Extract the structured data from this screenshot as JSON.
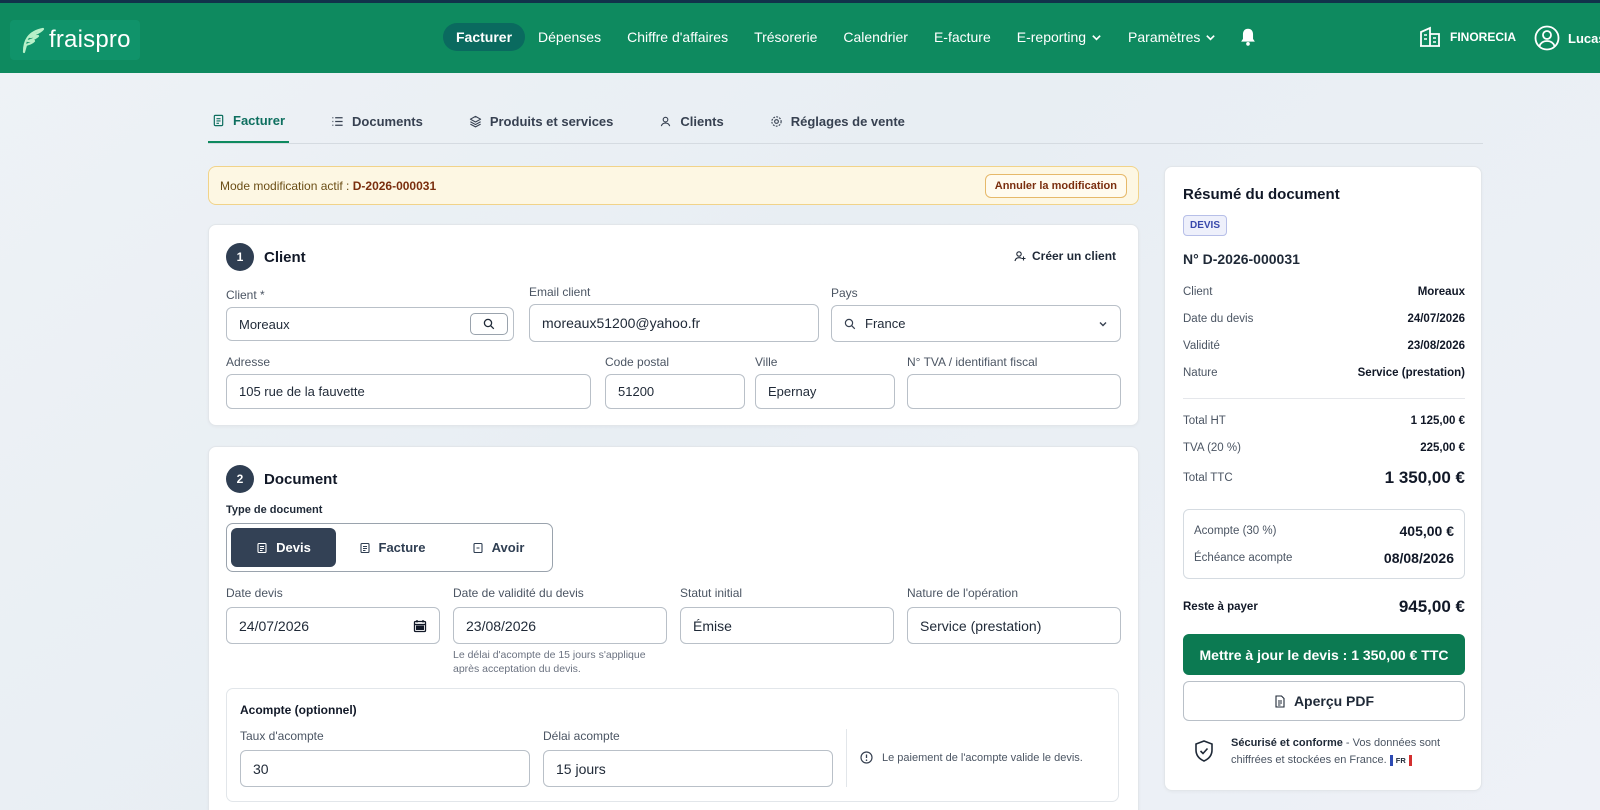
{
  "app": {
    "logo_text": "fraispro",
    "brand_color": "#0e8a5f"
  },
  "nav": {
    "items": [
      {
        "label": "Facturer"
      },
      {
        "label": "Dépenses"
      },
      {
        "label": "Chiffre d'affaires"
      },
      {
        "label": "Trésorerie"
      },
      {
        "label": "Calendrier"
      },
      {
        "label": "E-facture"
      },
      {
        "label": "E-reporting"
      },
      {
        "label": "Paramètres"
      }
    ],
    "org_name": "FINORECIA",
    "user_name": "Lucas"
  },
  "subtabs": [
    {
      "label": "Facturer",
      "icon": "invoice-icon"
    },
    {
      "label": "Documents",
      "icon": "list-icon"
    },
    {
      "label": "Produits et services",
      "icon": "layers-icon"
    },
    {
      "label": "Clients",
      "icon": "user-icon"
    },
    {
      "label": "Réglages de vente",
      "icon": "gear-icon"
    }
  ],
  "banner": {
    "prefix": "Mode modification actif : ",
    "doc_id": "D-2026-000031",
    "cancel_label": "Annuler la modification"
  },
  "client": {
    "step": "1",
    "title": "Client",
    "create_label": "Créer un client",
    "client_label": "Client *",
    "client_value": "Moreaux",
    "email_label": "Email client",
    "email_value": "moreaux51200@yahoo.fr",
    "country_label": "Pays",
    "country_value": "France",
    "address_label": "Adresse",
    "address_value": "105 rue de la fauvette",
    "postal_label": "Code postal",
    "postal_value": "51200",
    "city_label": "Ville",
    "city_value": "Epernay",
    "vat_label": "N° TVA / identifiant fiscal",
    "vat_value": ""
  },
  "document": {
    "step": "2",
    "title": "Document",
    "type_label": "Type de document",
    "types": [
      "Devis",
      "Facture",
      "Avoir"
    ],
    "selected_type": "Devis",
    "date_label": "Date devis",
    "date_value": "24/07/2026",
    "validity_label": "Date de validité du devis",
    "validity_value": "23/08/2026",
    "validity_help": "Le délai d'acompte de 15 jours s'applique après acceptation du devis.",
    "status_label": "Statut initial",
    "status_value": "Émise",
    "nature_label": "Nature de l'opération",
    "nature_value": "Service (prestation)",
    "deposit": {
      "title": "Acompte (optionnel)",
      "rate_label": "Taux d'acompte",
      "rate_value": "30",
      "delay_label": "Délai acompte",
      "delay_value": "15 jours",
      "info": "Le paiement de l'acompte valide le devis."
    }
  },
  "summary": {
    "title": "Résumé du document",
    "badge": "DEVIS",
    "number": "N° D-2026-000031",
    "rows": [
      {
        "label": "Client",
        "value": "Moreaux"
      },
      {
        "label": "Date du devis",
        "value": "24/07/2026"
      },
      {
        "label": "Validité",
        "value": "23/08/2026"
      },
      {
        "label": "Nature",
        "value": "Service (prestation)"
      }
    ],
    "total_ht_label": "Total HT",
    "total_ht": "1 125,00 €",
    "tva_label": "TVA (20 %)",
    "tva": "225,00 €",
    "total_ttc_label": "Total TTC",
    "total_ttc": "1 350,00 €",
    "deposit_label": "Acompte (30 %)",
    "deposit": "405,00 €",
    "deposit_due_label": "Échéance acompte",
    "deposit_due": "08/08/2026",
    "remaining_label": "Reste à payer",
    "remaining": "945,00 €",
    "update_label": "Mettre à jour le devis : 1 350,00 € TTC",
    "pdf_label": "Aperçu PDF",
    "secure_bold": "Sécurisé et conforme",
    "secure_text": " - Vos données sont chiffrées et stockées en France.",
    "flag_text": "FR"
  }
}
